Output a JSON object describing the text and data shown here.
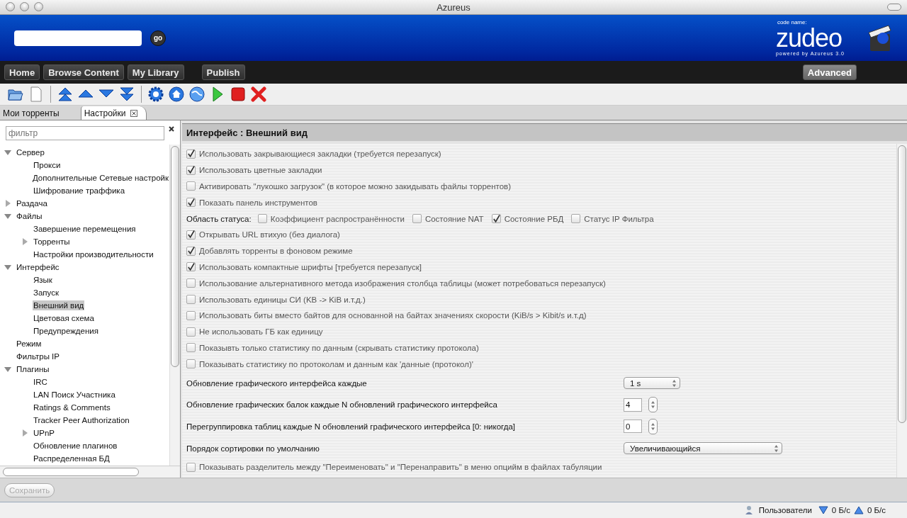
{
  "window": {
    "title": "Azureus"
  },
  "header": {
    "search_button": "go",
    "logo_caption": "code name:",
    "logo_name": "zudeo",
    "logo_tagline": "powered by Azureus 3.0"
  },
  "nav": {
    "items": [
      {
        "label": "Home",
        "selected": false
      },
      {
        "label": "Browse Content",
        "selected": false
      },
      {
        "label": "My Library",
        "selected": false
      },
      {
        "label": "Publish",
        "selected": false
      }
    ],
    "advanced": "Advanced"
  },
  "tabs": [
    {
      "label": "Мои торренты",
      "selected": false,
      "closable": false
    },
    {
      "label": "Настройки",
      "selected": true,
      "closable": true
    }
  ],
  "sidebar": {
    "filter_placeholder": "фильтр",
    "items": [
      {
        "label": "Сервер",
        "selected": false,
        "expanded": true,
        "children": [
          {
            "label": "Прокси",
            "selected": false
          },
          {
            "label": "Дополнительные Сетевые настройк",
            "selected": false
          },
          {
            "label": "Шифрование траффика",
            "selected": false
          }
        ]
      },
      {
        "label": "Раздача",
        "selected": false,
        "expanded": false
      },
      {
        "label": "Файлы",
        "selected": false,
        "expanded": true,
        "children": [
          {
            "label": "Завершение перемещения",
            "selected": false
          },
          {
            "label": "Торренты",
            "selected": false,
            "expanded": false
          },
          {
            "label": "Настройки производительности",
            "selected": false
          }
        ]
      },
      {
        "label": "Интерфейс",
        "selected": false,
        "expanded": true,
        "children": [
          {
            "label": "Язык",
            "selected": false
          },
          {
            "label": "Запуск",
            "selected": false
          },
          {
            "label": "Внешний вид",
            "selected": true
          },
          {
            "label": "Цветовая схема",
            "selected": false
          },
          {
            "label": "Предупреждения",
            "selected": false
          }
        ]
      },
      {
        "label": "Режим",
        "selected": false
      },
      {
        "label": "Фильтры IP",
        "selected": false
      },
      {
        "label": "Плагины",
        "selected": false,
        "expanded": true,
        "children": [
          {
            "label": "IRC",
            "selected": false
          },
          {
            "label": "LAN Поиск Участника",
            "selected": false
          },
          {
            "label": "Ratings & Comments",
            "selected": false
          },
          {
            "label": "Tracker Peer Authorization",
            "selected": false
          },
          {
            "label": "UPnP",
            "selected": false,
            "expanded": false
          },
          {
            "label": "Обновление плагинов",
            "selected": false
          },
          {
            "label": "Распределенная БД",
            "selected": false
          }
        ]
      }
    ]
  },
  "panel": {
    "title": "Интерфейс : Внешний вид",
    "settings": [
      {
        "kind": "checkbox",
        "label": "Использовать закрывающиеся закладки (требуется перезапуск)",
        "checked": true
      },
      {
        "kind": "checkbox",
        "label": "Использовать цветные закладки",
        "checked": true
      },
      {
        "kind": "checkbox",
        "label": "Активировать \"лукошко загрузок\" (в которое можно закидывать файлы торрентов)",
        "checked": false
      },
      {
        "kind": "checkbox",
        "label": "Показать панель инструментов",
        "checked": true
      },
      {
        "kind": "group",
        "label": "Область статуса:",
        "options": [
          {
            "label": "Коэффициент распространённости",
            "checked": false
          },
          {
            "label": "Состояние NAT",
            "checked": false
          },
          {
            "label": "Состояние РБД",
            "checked": true
          },
          {
            "label": "Статус IP Фильтра",
            "checked": false
          }
        ]
      },
      {
        "kind": "checkbox",
        "label": "Открывать URL втихую (без диалога)",
        "checked": true
      },
      {
        "kind": "checkbox",
        "label": "Добавлять торренты в фоновом режиме",
        "checked": true
      },
      {
        "kind": "checkbox",
        "label": "Использовать компактные шрифты [требуется перезапуск]",
        "checked": true
      },
      {
        "kind": "checkbox",
        "label": "Использование альтернативного метода изображения столбца таблицы (может потребоваться перезапуск)",
        "checked": false
      },
      {
        "kind": "checkbox",
        "label": "Использовать единицы СИ (KB -> KiB и.т.д.)",
        "checked": false
      },
      {
        "kind": "checkbox",
        "label": "Использовать биты вместо байтов для основанной на байтах значениях скорости (KiB/s > Kibit/s и.т.д)",
        "checked": false
      },
      {
        "kind": "checkbox",
        "label": "Не использовать ГБ  как единицу",
        "checked": false
      },
      {
        "kind": "checkbox",
        "label": "Показывть только статистику по данным (скрывать статистику протокола)",
        "checked": false
      },
      {
        "kind": "checkbox",
        "label": "Показывать статистику по протоколам и данным как 'данные (протокол)'",
        "checked": false
      },
      {
        "kind": "select",
        "label": "Обновление графического интерфейса каждые",
        "value": "1 s",
        "wide": false
      },
      {
        "kind": "spinner",
        "label": "Обновление графических балок каждые N обновлений графического интерфейса",
        "value": "4"
      },
      {
        "kind": "spinner",
        "label": "Перегруппировка таблиц каждые N обновлений графического интерфейса [0: никогда]",
        "value": "0"
      },
      {
        "kind": "select",
        "label": "Порядок сортировки по умолчанию",
        "value": "Увеличивающийся",
        "wide": true
      },
      {
        "kind": "checkbox",
        "label": "Показывать разделитель между  \"Переименовать\" и \"Перенаправить\" в меню опцийм в файлах табуляции",
        "checked": false
      }
    ]
  },
  "save_button": {
    "label": "Сохранить",
    "disabled": true
  },
  "status_bar": {
    "users": "Пользователи",
    "down": "0 Б/с",
    "up": "0 Б/с"
  }
}
